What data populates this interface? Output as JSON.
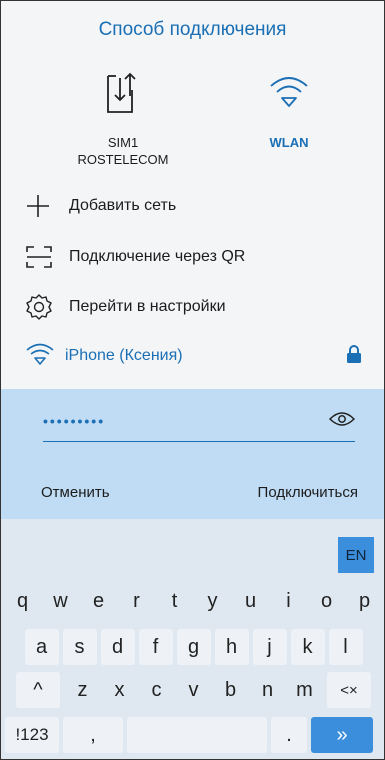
{
  "title": "Способ подключения",
  "connection_options": [
    {
      "label_line1": "SIM1",
      "label_line2": "ROSTELECOM",
      "icon": "sim-transfer-icon",
      "selected": false
    },
    {
      "label_line1": "WLAN",
      "icon": "wifi-icon",
      "selected": true
    }
  ],
  "menu": [
    {
      "label": "Добавить сеть",
      "icon": "plus-icon"
    },
    {
      "label": "Подключение через QR",
      "icon": "qr-scan-icon"
    },
    {
      "label": "Перейти в настройки",
      "icon": "gear-icon"
    }
  ],
  "network": {
    "name": "iPhone (Ксения)",
    "icon": "wifi-icon",
    "lock_icon": "lock-icon"
  },
  "password": {
    "masked_value": "•••••••••",
    "eye_icon": "eye-icon"
  },
  "actions": {
    "cancel": "Отменить",
    "connect": "Подключиться"
  },
  "keyboard": {
    "lang": "EN",
    "row1": [
      "q",
      "w",
      "e",
      "r",
      "t",
      "y",
      "u",
      "i",
      "o",
      "p"
    ],
    "row2": [
      "a",
      "s",
      "d",
      "f",
      "g",
      "h",
      "j",
      "k",
      "l"
    ],
    "row3": [
      "z",
      "x",
      "c",
      "v",
      "b",
      "n",
      "m"
    ],
    "shift": "^",
    "backspace": "<×",
    "num": "!123",
    "comma": ",",
    "dot": ".",
    "enter": "»"
  },
  "colors": {
    "accent": "#1a6fb5",
    "panel": "#bfdcf4",
    "key_blue": "#3a8edb"
  }
}
